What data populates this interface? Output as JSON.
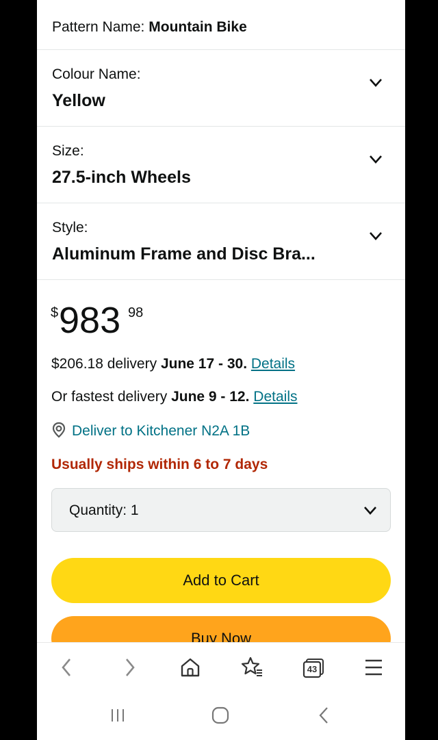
{
  "pattern": {
    "label": "Pattern Name:",
    "value": "Mountain Bike"
  },
  "dropdowns": [
    {
      "label": "Colour Name:",
      "value": "Yellow"
    },
    {
      "label": "Size:",
      "value": "27.5-inch Wheels"
    },
    {
      "label": "Style:",
      "value": "Aluminum Frame and Disc Bra..."
    }
  ],
  "price": {
    "currency": "$",
    "whole": "983",
    "fraction": "98"
  },
  "delivery": {
    "cost_text": "$206.18 delivery ",
    "dates": "June 17 - 30",
    "sep": ". ",
    "details": "Details"
  },
  "fastest": {
    "prefix": "Or fastest delivery ",
    "dates": "June 9 - 12",
    "sep": ". ",
    "details": "Details"
  },
  "deliver_to": "Deliver to Kitchener N2A 1B",
  "ships": "Usually ships within 6 to 7 days",
  "quantity": {
    "label": "Quantity:",
    "value": "1"
  },
  "buttons": {
    "add_to_cart": "Add to Cart",
    "buy_now": "Buy Now"
  },
  "browser": {
    "tab_count": "43"
  },
  "colors": {
    "link": "#007185",
    "ships": "#b12704",
    "cart": "#ffd814",
    "buy": "#ffa41c"
  }
}
